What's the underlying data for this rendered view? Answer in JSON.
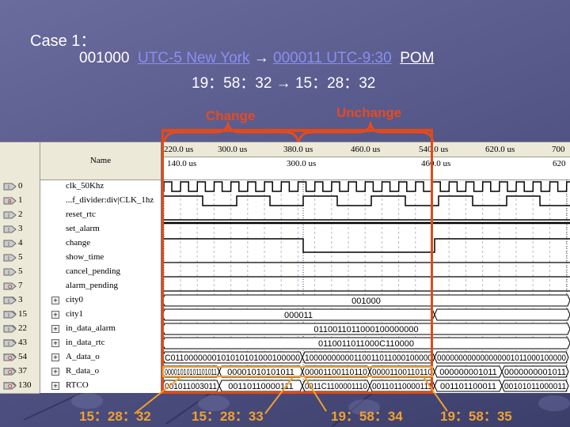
{
  "slide": {
    "title": "Case 1：",
    "line1": {
      "from_code": "001000",
      "from_city": "UTC-5  New York",
      "arrow": "→",
      "to_code_city": "000011  UTC-9:30",
      "to_abbr": "POM"
    },
    "line2": "19：58：32 → 15：28：32",
    "annotations": {
      "change": "Change",
      "unchange": "Unchange"
    },
    "time_labels": [
      "15：28：32",
      "15：28：33",
      "19：58：34",
      "19：58：35"
    ],
    "colors": {
      "annotation": "#e84a1e",
      "time_label": "#f0a030",
      "link": "#8a8ef0"
    }
  },
  "waveform": {
    "name_header": "Name",
    "ruler_top": [
      "220.0 us",
      "300.0 us",
      "380.0 us",
      "460.0 us",
      "540.0 us",
      "620.0 us",
      "700"
    ],
    "ruler_bottom": [
      "140.0 us",
      "300.0 us",
      "460.0 us",
      "620"
    ],
    "signals": [
      {
        "pin": "0",
        "type": "I",
        "name": "clk_50Khz",
        "bus": false
      },
      {
        "pin": "1",
        "type": "B",
        "name": "...f_divider:div|CLK_1hz",
        "bus": false
      },
      {
        "pin": "2",
        "type": "I",
        "name": "reset_rtc",
        "bus": false
      },
      {
        "pin": "3",
        "type": "I",
        "name": "set_alarm",
        "bus": false
      },
      {
        "pin": "4",
        "type": "I",
        "name": "change",
        "bus": false
      },
      {
        "pin": "5",
        "type": "I",
        "name": "show_time",
        "bus": false
      },
      {
        "pin": "5",
        "type": "I",
        "name": "cancel_pending",
        "bus": false
      },
      {
        "pin": "7",
        "type": "O",
        "name": "alarm_pending",
        "bus": false
      },
      {
        "pin": "3",
        "type": "I",
        "name": "city0",
        "bus": true
      },
      {
        "pin": "15",
        "type": "I",
        "name": "city1",
        "bus": true
      },
      {
        "pin": "22",
        "type": "I",
        "name": "in_data_alarm",
        "bus": true
      },
      {
        "pin": "43",
        "type": "I",
        "name": "in_data_rtc",
        "bus": true
      },
      {
        "pin": "54",
        "type": "O",
        "name": "A_data_o",
        "bus": true
      },
      {
        "pin": "37",
        "type": "O",
        "name": "R_data_o",
        "bus": true
      },
      {
        "pin": "130",
        "type": "O",
        "name": "RTCO",
        "bus": true
      }
    ],
    "bus_values": {
      "city0": "001000",
      "city1": "000011",
      "in_data_alarm": "0110011011000100000000",
      "in_data_rtc": "0110011011000C110000",
      "A_data_o": [
        "C0110000000101010101000100000",
        "10000000000110011011000100000",
        "000000000000000001011000100000"
      ],
      "R_data_o": [
        "00001010101101011",
        "00001010101011",
        "00001100110110",
        "000000001011",
        "0000000001011"
      ],
      "RTCO": [
        "001011003011",
        "00110110000111",
        "0011C1100001110",
        "00110110000111",
        "001101100011",
        "00101011000011"
      ]
    }
  }
}
